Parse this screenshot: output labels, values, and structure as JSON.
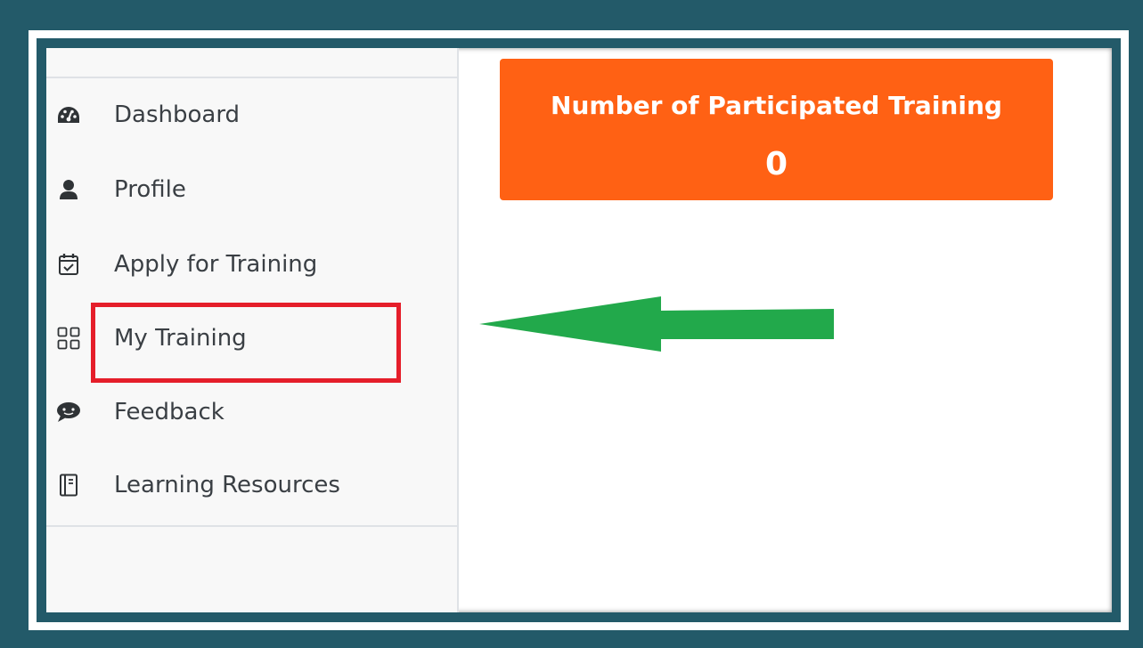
{
  "sidebar": {
    "items": [
      {
        "label": "Dashboard",
        "icon": "dashboard-icon"
      },
      {
        "label": "Profile",
        "icon": "user-icon"
      },
      {
        "label": "Apply for Training",
        "icon": "calendar-check-icon"
      },
      {
        "label": "My Training",
        "icon": "grid-icon",
        "highlighted": true
      },
      {
        "label": "Feedback",
        "icon": "chat-bubble-icon"
      },
      {
        "label": "Learning Resources",
        "icon": "book-icon"
      }
    ]
  },
  "stat_card": {
    "title": "Number of Participated Training",
    "value": "0",
    "color": "#ff6114"
  },
  "annotations": {
    "highlight_color": "#e51e2a",
    "arrow_color": "#22a94b",
    "arrow_direction": "left"
  }
}
